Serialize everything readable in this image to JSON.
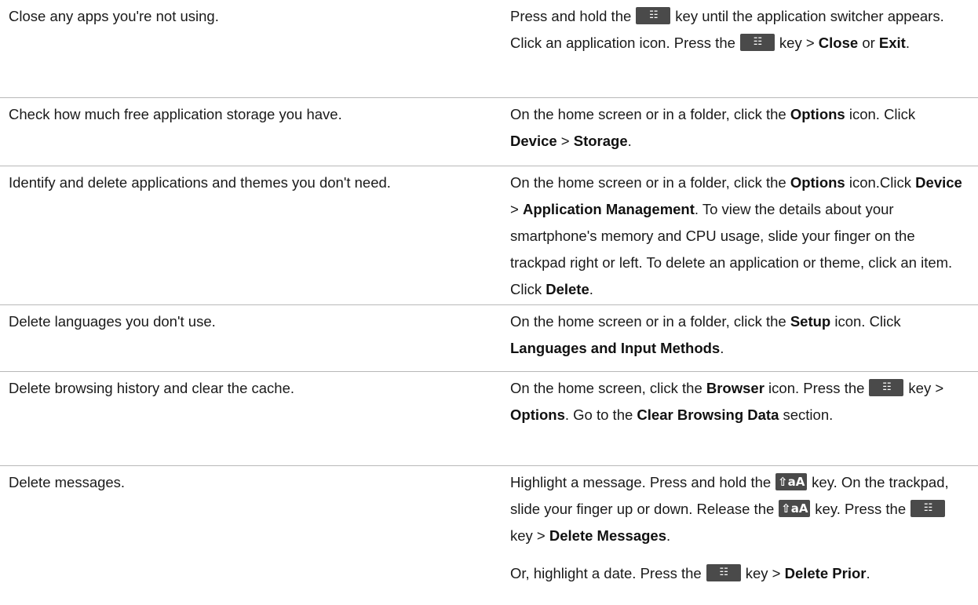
{
  "rows": [
    {
      "tip": "Close any apps you're not using.",
      "a": {
        "t1": "Press and hold the",
        "menu_key": "☷",
        "t2": "key until the application switcher appears. Click an application icon. Press the",
        "menu_key2": "☷",
        "t3": "key >",
        "b1": "Close",
        "t4": "or",
        "b2": "Exit",
        "t5": "."
      }
    },
    {
      "tip": "Check how much free application storage you have.",
      "a": {
        "t1": "On the home screen or in a folder, click the",
        "b1": "Options",
        "t2": "icon. Click",
        "b2": "Device",
        "t3": ">",
        "b3": "Storage",
        "t4": "."
      }
    },
    {
      "tip": "Identify and delete applications and themes you don't need.",
      "a": {
        "t1": "On the home screen or in a folder, click the",
        "b1": "Options",
        "t2": "icon.Click",
        "b2": "Device",
        "t3": ">",
        "b3": "Application Management",
        "t4": ". To view the details about your smartphone's memory and CPU usage, slide your finger on the trackpad right or left. To delete an application or theme, click an item. Click",
        "b4": "Delete",
        "t5": "."
      }
    },
    {
      "tip": "Delete languages you don't use.",
      "a": {
        "t1": "On the home screen or in a folder, click the",
        "b1": "Setup",
        "t2": "icon. Click",
        "b2": "Languages and Input Methods",
        "t3": "."
      }
    },
    {
      "tip": "Delete browsing history and clear the cache.",
      "a": {
        "t1": "On the home screen, click the",
        "b1": "Browser",
        "t2": "icon. Press the",
        "menu_key": "☷",
        "t3": "key >",
        "b2": "Options",
        "t4": ". Go to the",
        "b3": "Clear Browsing Data",
        "t5": "section."
      }
    },
    {
      "tip": "Delete messages.",
      "a": {
        "t1": "Highlight a message. Press and hold the",
        "shift_key": "⇧aA",
        "t2": "key. On the trackpad, slide your finger up or down. Release the",
        "shift_key2": "⇧aA",
        "t3": "key. Press the",
        "menu_key": "☷",
        "t4": "key >",
        "b1": "Delete Messages",
        "t5": "."
      },
      "a2": {
        "t1": "Or, highlight a date. Press the",
        "menu_key": "☷",
        "t2": "key >",
        "b1": "Delete Prior",
        "t3": "."
      }
    }
  ]
}
